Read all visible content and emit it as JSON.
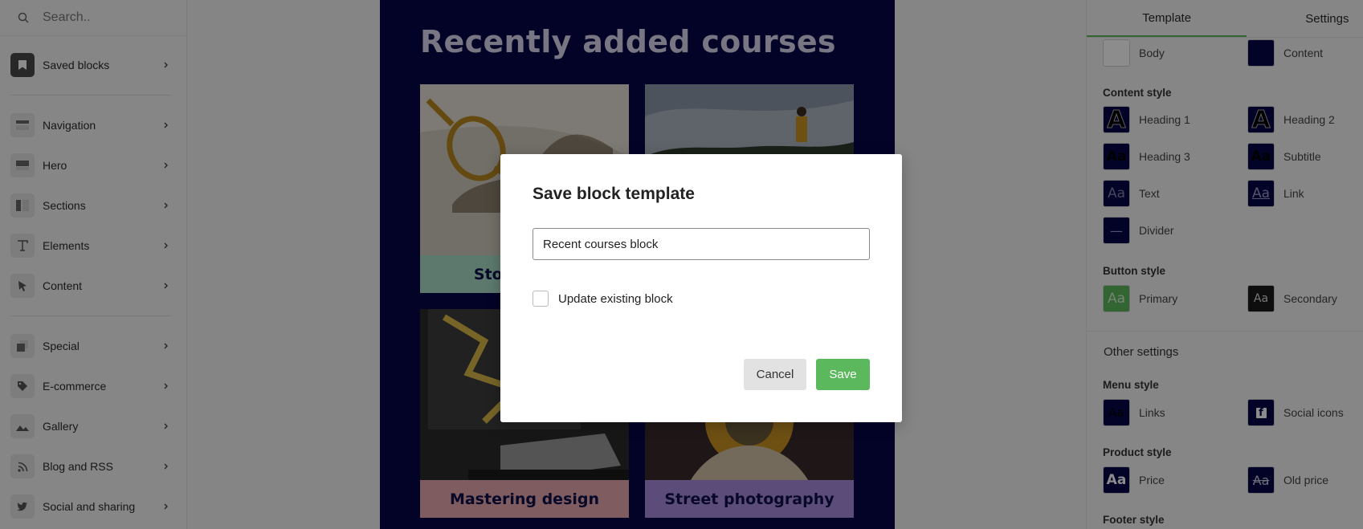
{
  "search": {
    "placeholder": "Search.."
  },
  "sidebar": {
    "items": [
      {
        "label": "Saved blocks",
        "icon": "bookmark-icon"
      },
      {
        "label": "Navigation",
        "icon": "navigation-icon"
      },
      {
        "label": "Hero",
        "icon": "hero-icon"
      },
      {
        "label": "Sections",
        "icon": "sections-icon"
      },
      {
        "label": "Elements",
        "icon": "text-icon"
      },
      {
        "label": "Content",
        "icon": "cursor-icon"
      },
      {
        "label": "Special",
        "icon": "special-icon"
      },
      {
        "label": "E-commerce",
        "icon": "tag-icon"
      },
      {
        "label": "Gallery",
        "icon": "image-icon"
      },
      {
        "label": "Blog and RSS",
        "icon": "rss-icon"
      },
      {
        "label": "Social and sharing",
        "icon": "twitter-icon"
      }
    ]
  },
  "email": {
    "title": "Recently added courses",
    "cards": [
      {
        "caption": "Storytelling",
        "caption_bg": "#a9dcc8"
      },
      {
        "caption": "",
        "caption_bg": "#6a6a6a"
      },
      {
        "caption": "Mastering design",
        "caption_bg": "#e8a8ad"
      },
      {
        "caption": "Street photography",
        "caption_bg": "#a78bdc"
      }
    ]
  },
  "modal": {
    "title": "Save block template",
    "input_value": "Recent courses block",
    "checkbox_label": "Update existing block",
    "checkbox_checked": false,
    "cancel_label": "Cancel",
    "save_label": "Save"
  },
  "right_panel": {
    "tabs": [
      "Template",
      "Settings"
    ],
    "active_tab": "Template",
    "colors": [
      {
        "label": "Body",
        "color": "#ffffff"
      },
      {
        "label": "Content",
        "color": "#07074a"
      }
    ],
    "content_style_title": "Content style",
    "content_styles": [
      {
        "label": "Heading 1",
        "glyph": "A"
      },
      {
        "label": "Heading 2",
        "glyph": "A"
      },
      {
        "label": "Heading 3",
        "glyph": "Aa"
      },
      {
        "label": "Subtitle",
        "glyph": "Aa"
      },
      {
        "label": "Text",
        "glyph": "Aa"
      },
      {
        "label": "Link",
        "glyph": "Aa"
      },
      {
        "label": "Divider",
        "glyph": "—"
      }
    ],
    "button_style_title": "Button style",
    "button_styles": [
      {
        "label": "Primary",
        "glyph": "Aa",
        "color": "#5cb85c"
      },
      {
        "label": "Secondary",
        "glyph": "Aa",
        "color": "#1a1a1a"
      }
    ],
    "other_settings_title": "Other settings",
    "menu_style_title": "Menu style",
    "menu_styles": [
      {
        "label": "Links",
        "glyph": "Aa"
      },
      {
        "label": "Social icons",
        "glyph": "f"
      }
    ],
    "product_style_title": "Product style",
    "product_styles": [
      {
        "label": "Price",
        "glyph": "Aa"
      },
      {
        "label": "Old price",
        "glyph": "Aa"
      }
    ],
    "footer_style_title": "Footer style"
  }
}
